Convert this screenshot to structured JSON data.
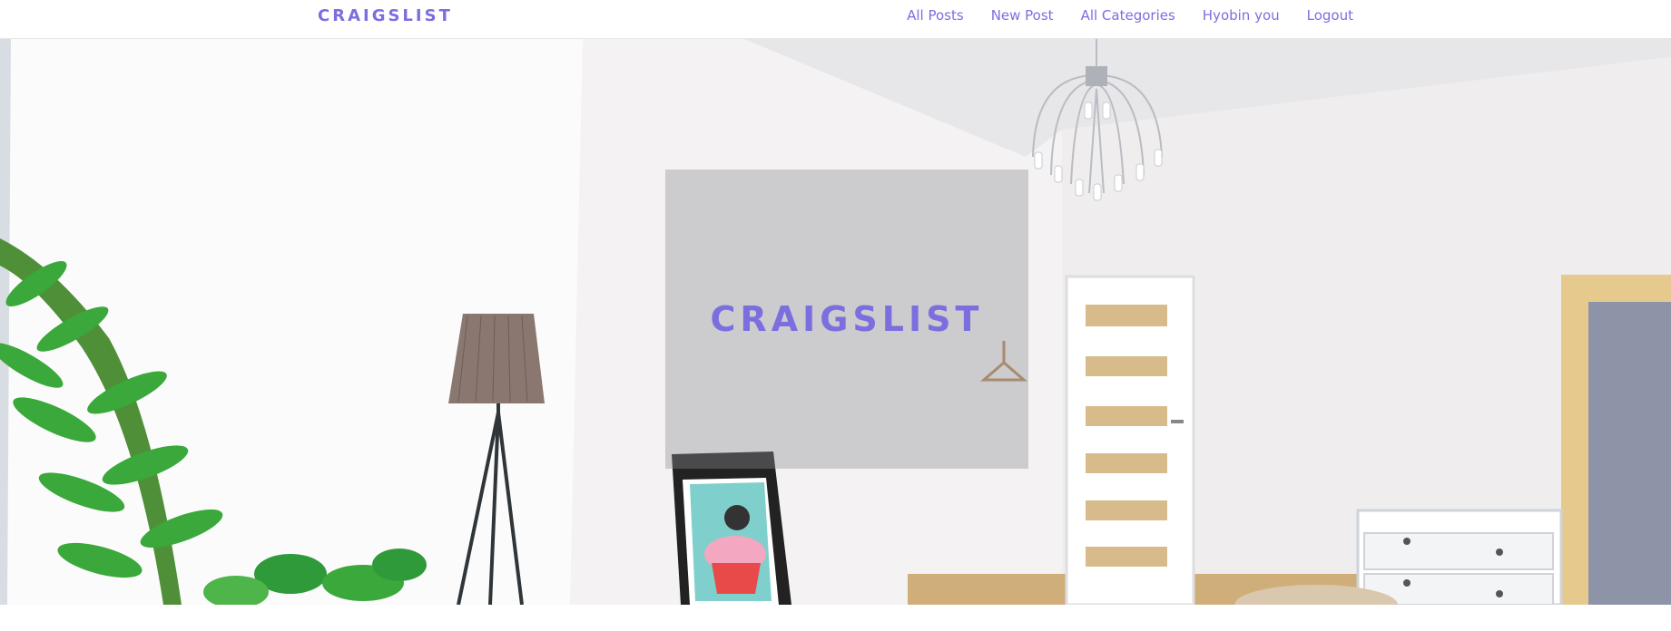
{
  "navbar": {
    "brand": "CRAIGSLIST",
    "links": [
      {
        "label": "All Posts"
      },
      {
        "label": "New Post"
      },
      {
        "label": "All Categories"
      },
      {
        "label": "Hyobin you"
      },
      {
        "label": "Logout"
      }
    ]
  },
  "hero": {
    "title": "CRAIGSLIST",
    "background_image": "bright-white-bedroom-photo"
  },
  "colors": {
    "accent": "#7b6fe0",
    "navbar_bg": "#ffffff"
  }
}
